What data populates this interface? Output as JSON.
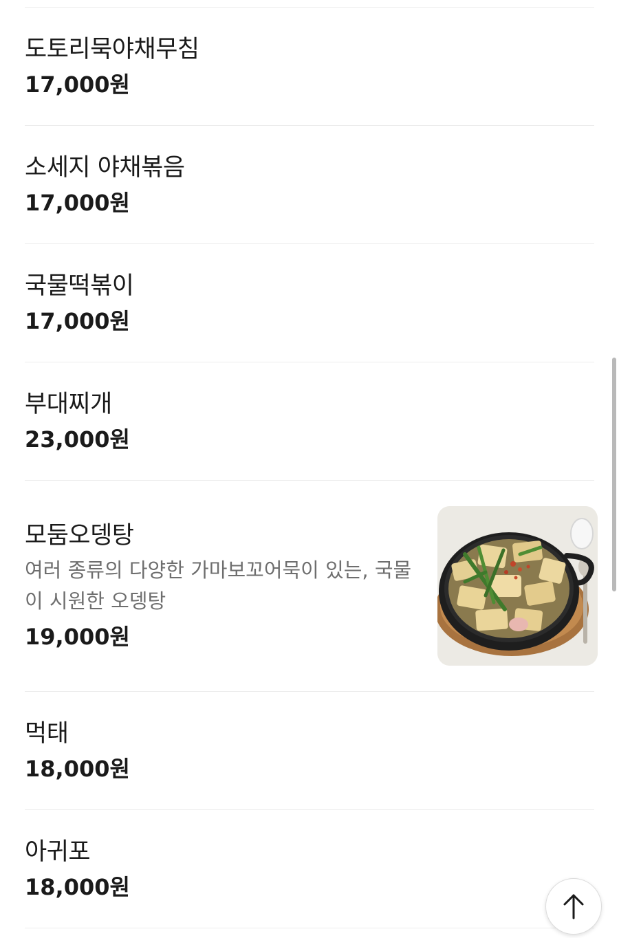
{
  "menu": {
    "items": [
      {
        "name": "도토리묵야채무침",
        "price": "17,000원"
      },
      {
        "name": "소세지 야채볶음",
        "price": "17,000원"
      },
      {
        "name": "국물떡볶이",
        "price": "17,000원"
      },
      {
        "name": "부대찌개",
        "price": "23,000원"
      },
      {
        "name": "모둠오뎅탕",
        "description": "여러 종류의 다양한 가마보꼬어묵이 있는, 국물이 시원한 오뎅탕",
        "price": "19,000원"
      },
      {
        "name": "먹태",
        "price": "18,000원"
      },
      {
        "name": "아귀포",
        "price": "18,000원"
      }
    ]
  },
  "icons": {
    "scroll_top": "arrow-up-icon"
  }
}
